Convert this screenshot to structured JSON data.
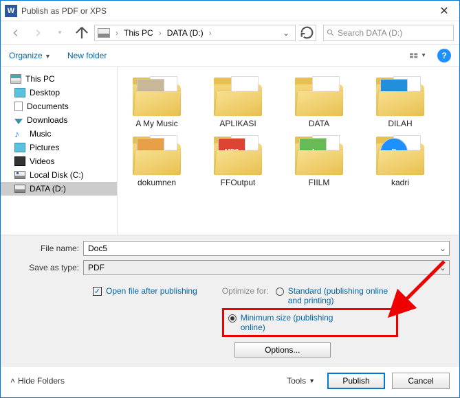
{
  "window": {
    "title": "Publish as PDF or XPS"
  },
  "nav": {
    "breadcrumb": {
      "root": "This PC",
      "drive": "DATA (D:)"
    },
    "search_placeholder": "Search DATA (D:)"
  },
  "toolbar": {
    "organize": "Organize",
    "new_folder": "New folder"
  },
  "tree": {
    "pc": "This PC",
    "items": [
      "Desktop",
      "Documents",
      "Downloads",
      "Music",
      "Pictures",
      "Videos",
      "Local Disk (C:)",
      "DATA (D:)"
    ]
  },
  "files": [
    "A My Music",
    "APLIKASI",
    "DATA",
    "DILAH",
    "dokumnen",
    "FFOutput",
    "FIILM",
    "kadri"
  ],
  "form": {
    "filename_label": "File name:",
    "filename_value": "Doc5",
    "saveastype_label": "Save as type:",
    "saveastype_value": "PDF",
    "open_after": "Open file after publishing",
    "optimize_label": "Optimize for:",
    "opt_standard": "Standard (publishing online and printing)",
    "opt_minimum": "Minimum size (publishing online)",
    "options_btn": "Options..."
  },
  "footer": {
    "hide_folders": "Hide Folders",
    "tools": "Tools",
    "publish": "Publish",
    "cancel": "Cancel"
  }
}
